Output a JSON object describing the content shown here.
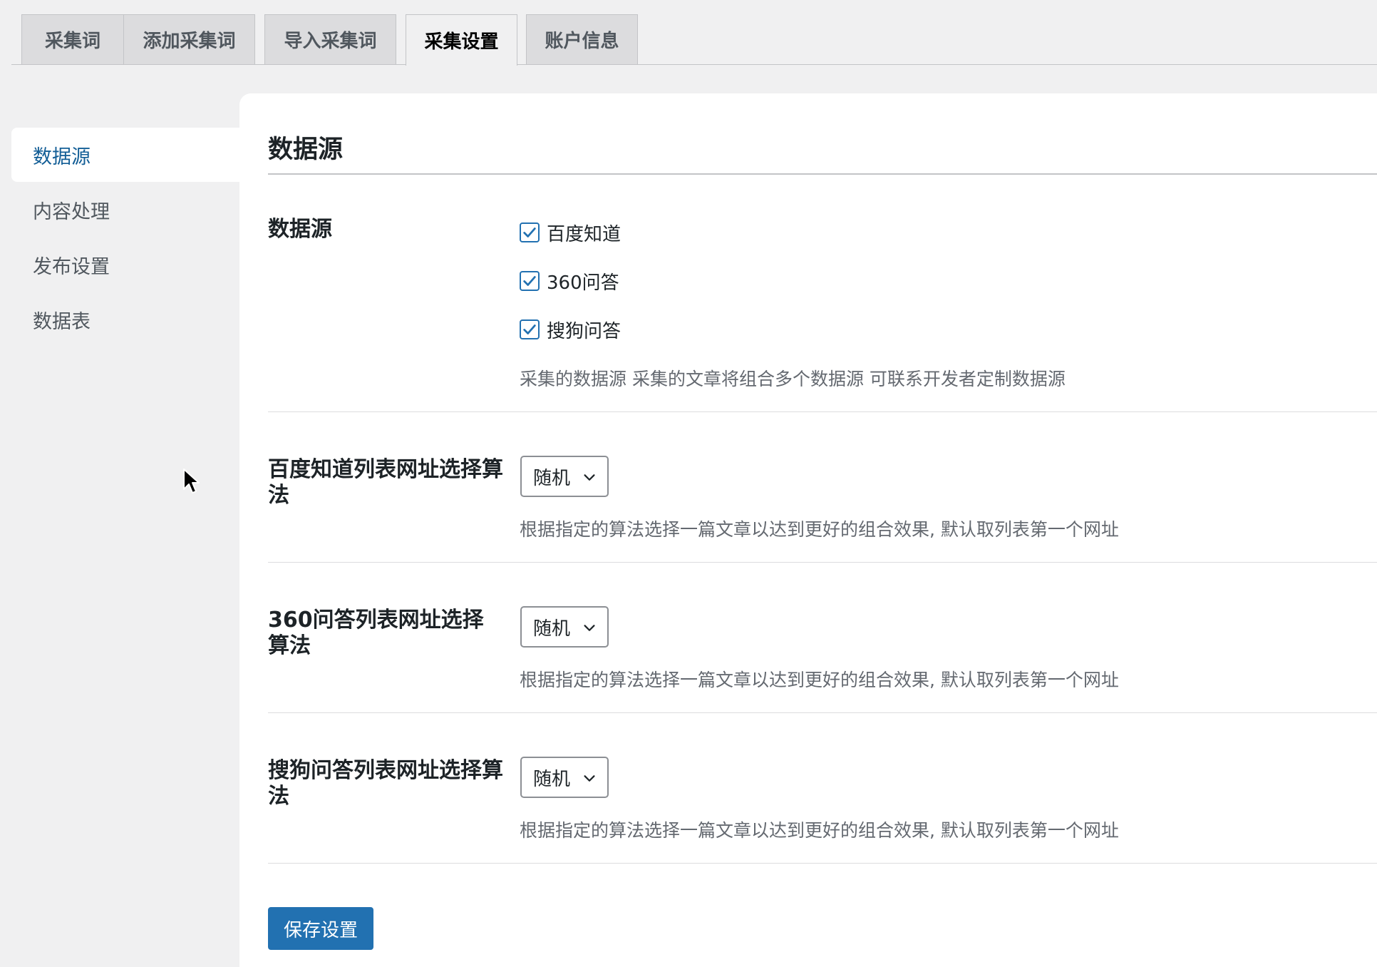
{
  "tabs": [
    {
      "label": "采集词"
    },
    {
      "label": "添加采集词"
    },
    {
      "label": "导入采集词"
    },
    {
      "label": "采集设置"
    },
    {
      "label": "账户信息"
    }
  ],
  "active_tab": "采集设置",
  "sidebar": {
    "items": [
      {
        "label": "数据源"
      },
      {
        "label": "内容处理"
      },
      {
        "label": "发布设置"
      },
      {
        "label": "数据表"
      }
    ],
    "active": "数据源"
  },
  "section": {
    "title": "数据源",
    "datasource": {
      "label": "数据源",
      "options": [
        {
          "label": "百度知道",
          "checked": true
        },
        {
          "label": "360问答",
          "checked": true
        },
        {
          "label": "搜狗问答",
          "checked": true
        }
      ],
      "description": "采集的数据源 采集的文章将组合多个数据源 可联系开发者定制数据源"
    },
    "algorithms": [
      {
        "label": "百度知道列表网址选择算法",
        "value": "随机",
        "description": "根据指定的算法选择一篇文章以达到更好的组合效果, 默认取列表第一个网址"
      },
      {
        "label": "360问答列表网址选择算法",
        "value": "随机",
        "description": "根据指定的算法选择一篇文章以达到更好的组合效果, 默认取列表第一个网址"
      },
      {
        "label": "搜狗问答列表网址选择算法",
        "value": "随机",
        "description": "根据指定的算法选择一篇文章以达到更好的组合效果, 默认取列表第一个网址"
      }
    ],
    "save_label": "保存设置"
  },
  "colors": {
    "accent": "#2271b1",
    "active_sidebar_text": "#135e96",
    "background": "#f0f0f1"
  }
}
